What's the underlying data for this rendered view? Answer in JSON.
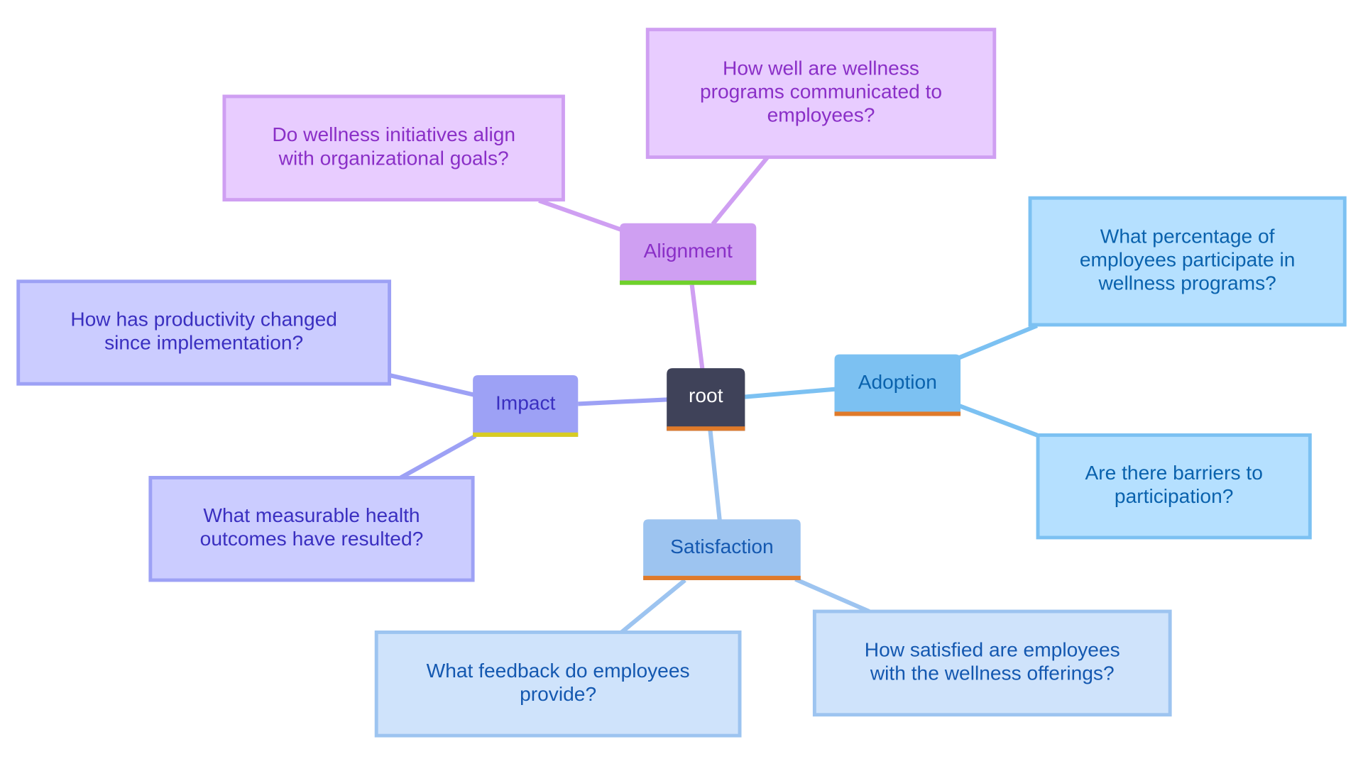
{
  "root": {
    "label": "root",
    "fill": "#3f4259",
    "text_color": "#ffffff",
    "underline": "#e07a2a"
  },
  "branches": [
    {
      "id": "alignment",
      "label": "Alignment",
      "fill": "#cf9ff2",
      "text_color": "#8a2fc7",
      "underline": "#6ed12a",
      "edge": "#cf9ff2",
      "leaf_fill": "#e8ccff",
      "leaves": [
        {
          "lines": [
            "Do wellness initiatives align",
            "with organizational goals?"
          ]
        },
        {
          "lines": [
            "How well are wellness",
            "programs communicated to",
            "employees?"
          ]
        }
      ]
    },
    {
      "id": "adoption",
      "label": "Adoption",
      "fill": "#7cc1f2",
      "text_color": "#0a62ad",
      "underline": "#e07a2a",
      "edge": "#7cc1f2",
      "leaf_fill": "#b5e0ff",
      "leaves": [
        {
          "lines": [
            "What percentage of",
            "employees participate in",
            "wellness programs?"
          ]
        },
        {
          "lines": [
            "Are there barriers to",
            "participation?"
          ]
        }
      ]
    },
    {
      "id": "satisfaction",
      "label": "Satisfaction",
      "fill": "#9dc4f0",
      "text_color": "#1458b0",
      "underline": "#e07a2a",
      "edge": "#9dc4f0",
      "leaf_fill": "#cfe3fb",
      "leaves": [
        {
          "lines": [
            "What feedback do employees",
            "provide?"
          ]
        },
        {
          "lines": [
            "How satisfied are employees",
            "with the wellness offerings?"
          ]
        }
      ]
    },
    {
      "id": "impact",
      "label": "Impact",
      "fill": "#9da1f5",
      "text_color": "#3a2fc0",
      "underline": "#d8cc22",
      "edge": "#9da1f5",
      "leaf_fill": "#cbccff",
      "leaves": [
        {
          "lines": [
            "How has productivity changed",
            "since implementation?"
          ]
        },
        {
          "lines": [
            "What measurable health",
            "outcomes have resulted?"
          ]
        }
      ]
    }
  ]
}
